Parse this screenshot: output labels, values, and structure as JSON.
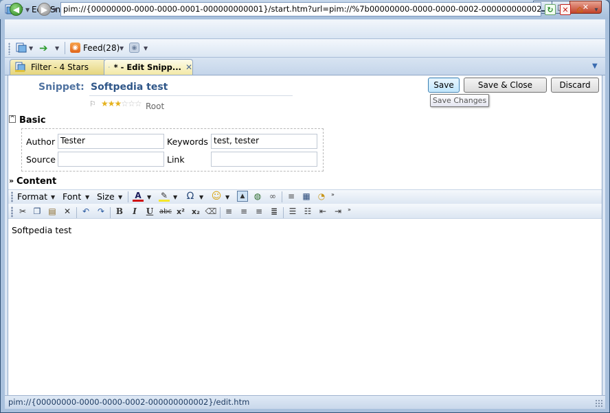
{
  "window": {
    "title": "* - Edit Snippet * - PIMShell",
    "min_glyph": "▁",
    "max_glyph": "□",
    "close_glyph": "✕"
  },
  "nav": {
    "address": "pim://{00000000-0000-0000-0001-000000000001}/start.htm?url=pim://%7b00000000-0000-0000-0002-000000000002%7d/edit.htm",
    "back_glyph": "◀",
    "forward_glyph": "▶"
  },
  "toolbar2": {
    "feed_label": "Feed(28)"
  },
  "tabs": [
    {
      "label": "Filter - 4 Stars"
    },
    {
      "label": "* - Edit Snipp..."
    }
  ],
  "snippet": {
    "label": "Snippet:",
    "title": "Softpedia test",
    "rating": 3,
    "rating_max": 6,
    "folder": "Root"
  },
  "buttons": {
    "save": "Save",
    "save_close": "Save & Close",
    "discard": "Discard",
    "tooltip": "Save Changes"
  },
  "basic": {
    "heading": "Basic",
    "author_label": "Author",
    "author_value": "Tester",
    "keywords_label": "Keywords",
    "keywords_value": "test, tester",
    "source_label": "Source",
    "source_value": "",
    "link_label": "Link",
    "link_value": ""
  },
  "content": {
    "heading": "Content",
    "toolbar": {
      "format": "Format",
      "font": "Font",
      "size": "Size"
    },
    "text": "Softpedia test"
  },
  "status": {
    "text": "pim://{00000000-0000-0000-0002-000000000002}/edit.htm"
  },
  "colors": {
    "accent": "#2f5688",
    "tab_active": "#f3e9a6",
    "save_button": "#bee6fd"
  }
}
